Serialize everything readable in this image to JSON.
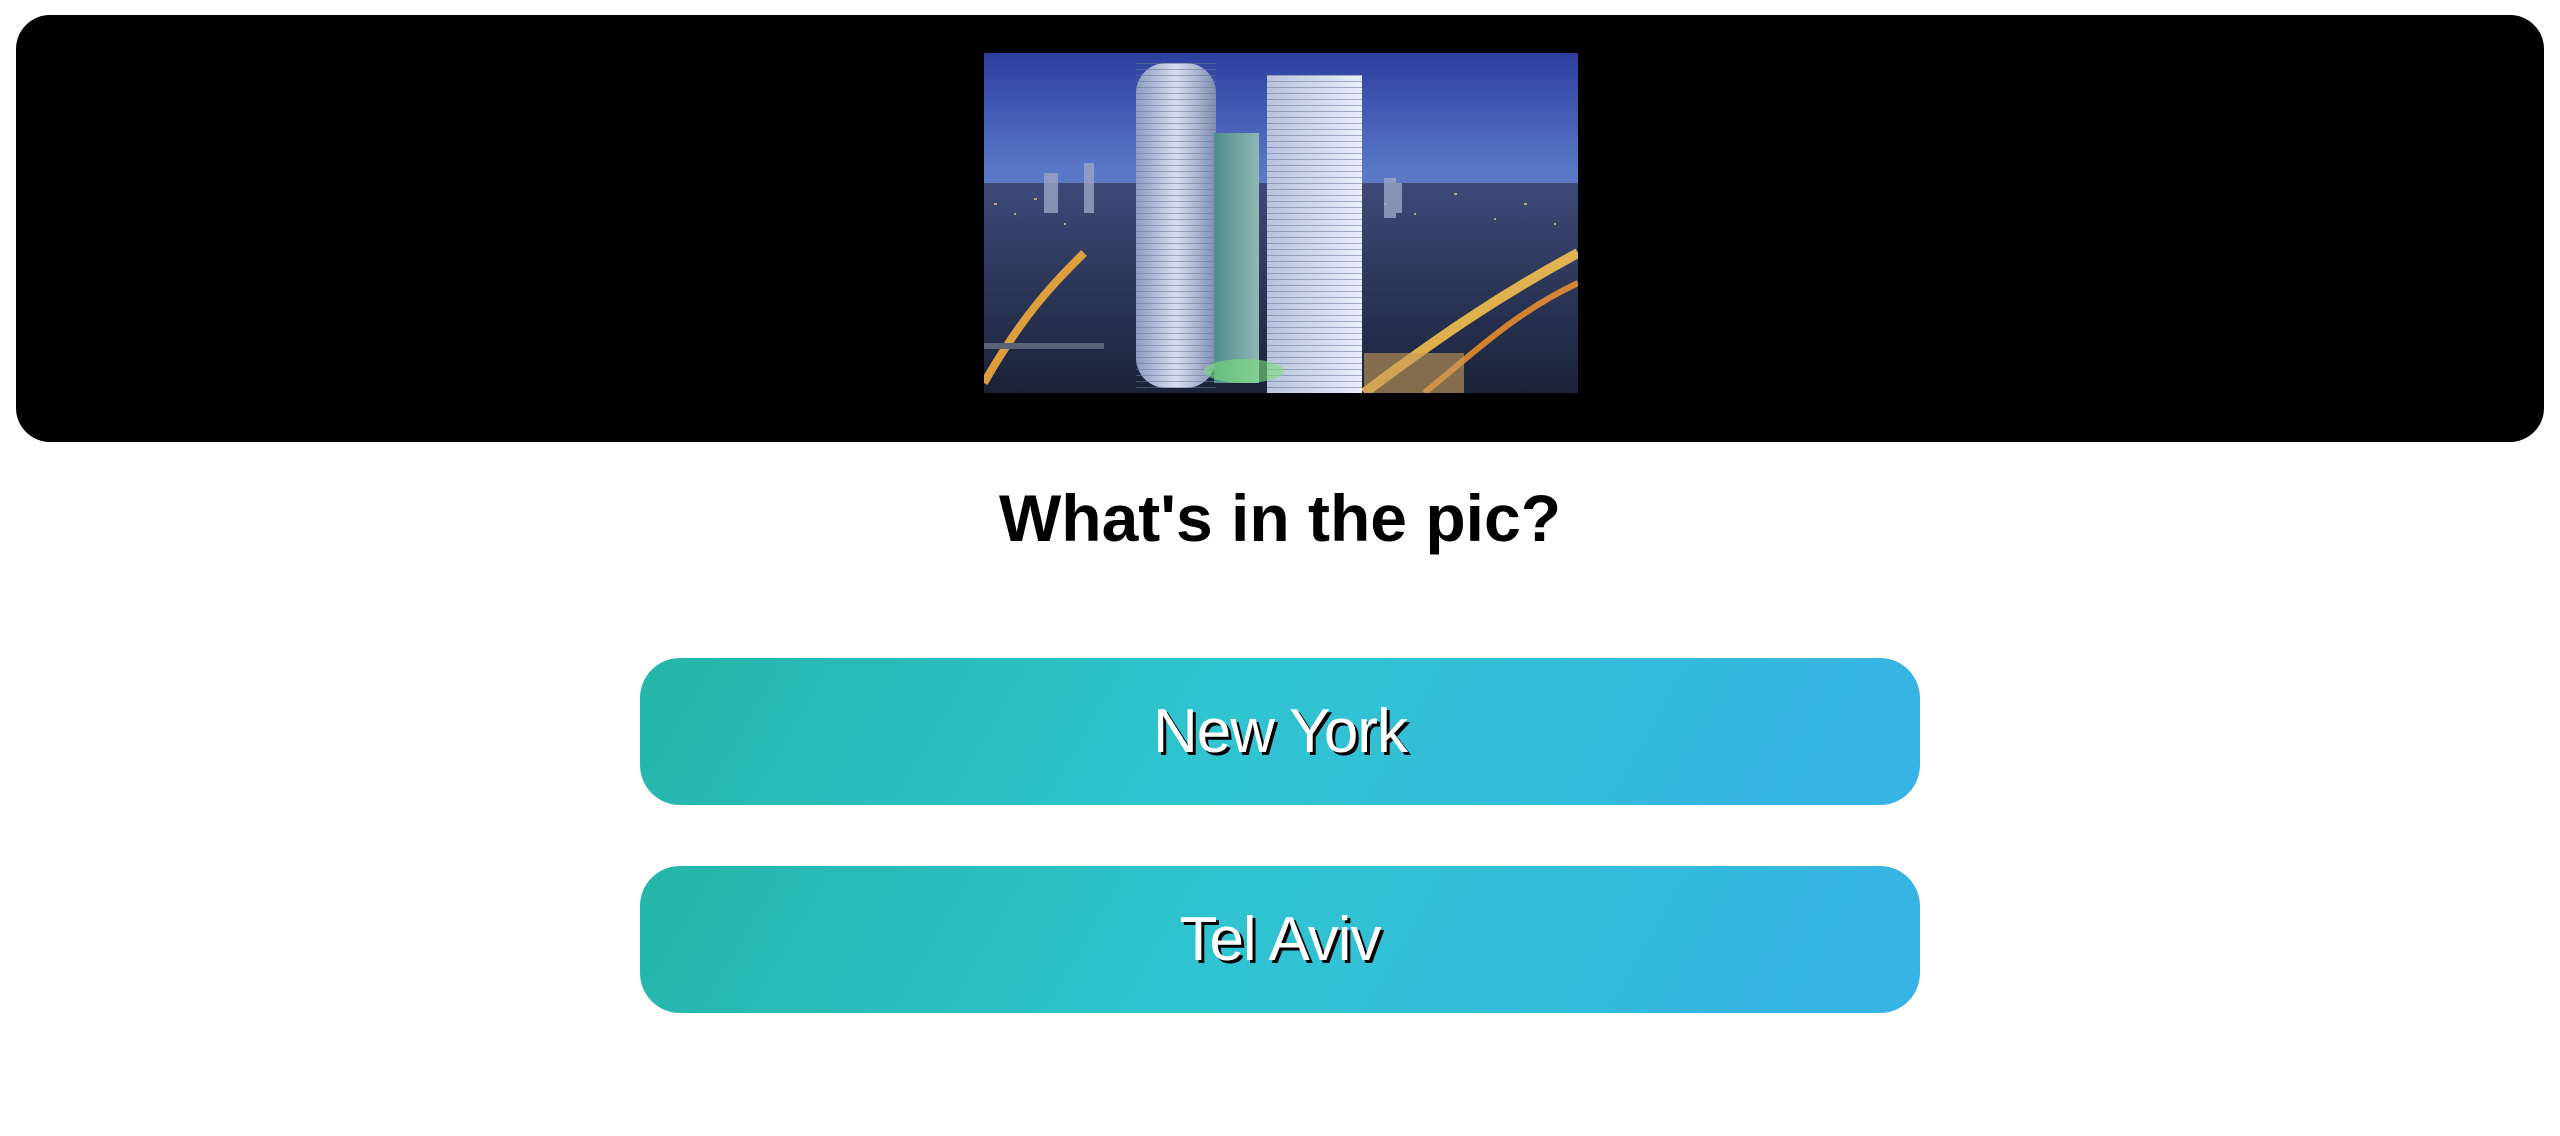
{
  "hero": {
    "image_description_icon": "city-skyline-photo"
  },
  "question": {
    "text": "What's in the pic?"
  },
  "answers": [
    {
      "label": "New York"
    },
    {
      "label": "Tel Aviv"
    }
  ],
  "colors": {
    "hero_background": "#000000",
    "button_gradient_start": "#24b5a8",
    "button_gradient_mid": "#2fc4d0",
    "button_gradient_end": "#38b2e6",
    "button_text": "#ffffff"
  }
}
